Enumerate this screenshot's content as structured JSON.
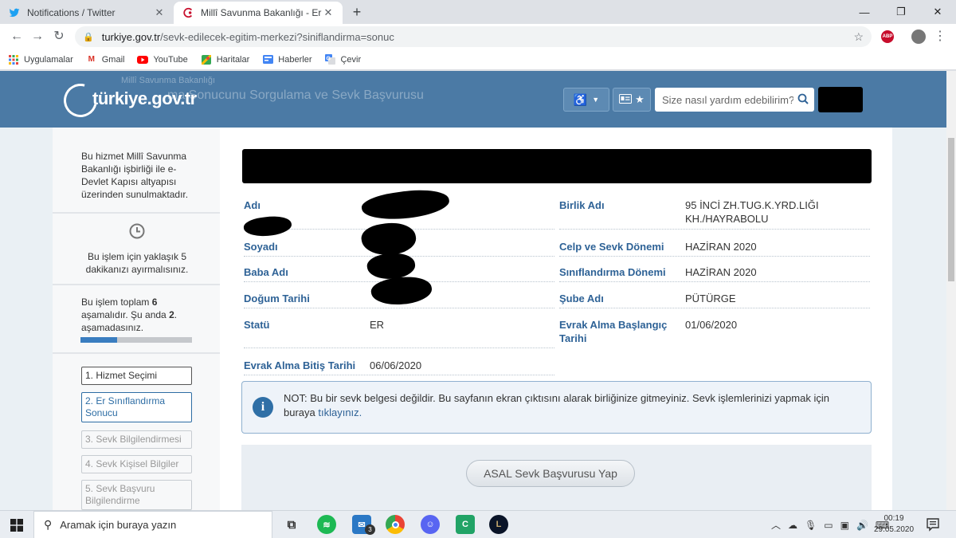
{
  "browser": {
    "tabs": [
      {
        "title": "Notifications / Twitter",
        "active": false
      },
      {
        "title": "Millî Savunma Bakanlığı - Er Sınıf",
        "active": true
      }
    ],
    "new_tab": "+",
    "url_host": "turkiye.gov.tr",
    "url_path": "/sevk-edilecek-egitim-merkezi?siniflandirma=sonuc",
    "abp_label": "ABP",
    "bookmarks": [
      {
        "label": "Uygulamalar",
        "icon": "apps-grid-icon"
      },
      {
        "label": "Gmail",
        "icon": "gmail-icon"
      },
      {
        "label": "YouTube",
        "icon": "youtube-icon"
      },
      {
        "label": "Haritalar",
        "icon": "maps-icon"
      },
      {
        "label": "Haberler",
        "icon": "news-icon"
      },
      {
        "label": "Çevir",
        "icon": "translate-icon"
      }
    ]
  },
  "site": {
    "logo": "türkiye.gov.tr",
    "ghost_ministry": "Millî Savunma Bakanlığı",
    "ghost_title": "ma Sonucunu Sorgulama ve Sevk Başvurusu",
    "search_placeholder": "Size nasıl yardım edebilirim?"
  },
  "sidebar": {
    "info": "Bu hizmet Millî Savunma Bakanlığı işbirliği ile e-Devlet Kapısı altyapısı üzerinden sunulmaktadır.",
    "time_text": "Bu işlem için yaklaşık 5 dakikanızı ayırmalısınız.",
    "steps_text_a": "Bu işlem toplam ",
    "steps_total": "6",
    "steps_text_b": " aşamalıdır. Şu anda ",
    "steps_current": "2",
    "steps_text_c": ". aşamadasınız.",
    "progress": 0.33,
    "steps": [
      {
        "label": "1. Hizmet Seçimi",
        "state": "done"
      },
      {
        "label": "2. Er Sınıflandırma Sonucu",
        "state": "current"
      },
      {
        "label": "3. Sevk Bilgilendirmesi",
        "state": "pending"
      },
      {
        "label": "4. Sevk Kişisel Bilgiler",
        "state": "pending"
      },
      {
        "label": "5. Sevk Başvuru Bilgilendirme",
        "state": "pending"
      }
    ]
  },
  "result": {
    "left": [
      {
        "label": "Adı",
        "value": ""
      },
      {
        "label": "Soyadı",
        "value": ""
      },
      {
        "label": "Baba Adı",
        "value": ""
      },
      {
        "label": "Doğum Tarihi",
        "value": ""
      },
      {
        "label": "Statü",
        "value": "ER"
      },
      {
        "label": "Evrak Alma Bitiş Tarihi",
        "value": "06/06/2020"
      }
    ],
    "right": [
      {
        "label": "Birlik Adı",
        "value": "95 İNCİ ZH.TUG.K.YRD.LIĞI KH./HAYRABOLU"
      },
      {
        "label": "Celp ve Sevk Dönemi",
        "value": "HAZİRAN 2020"
      },
      {
        "label": "Sınıflandırma Dönemi",
        "value": "HAZİRAN 2020"
      },
      {
        "label": "Şube Adı",
        "value": "PÜTÜRGE"
      },
      {
        "label": "Evrak Alma Başlangıç Tarihi",
        "value": "01/06/2020"
      }
    ]
  },
  "note": {
    "text": "NOT: Bu bir sevk belgesi değildir. Bu sayfanın ekran çıktısını alarak birliğinize gitmeyiniz. Sevk işlemlerinizi yapmak için buraya ",
    "link": "tıklayınız."
  },
  "action_button": "ASAL Sevk Başvurusu Yap",
  "taskbar": {
    "search_placeholder": "Aramak için buraya yazın",
    "mail_badge": "3",
    "time": "00:19",
    "date": "29.05.2020"
  }
}
